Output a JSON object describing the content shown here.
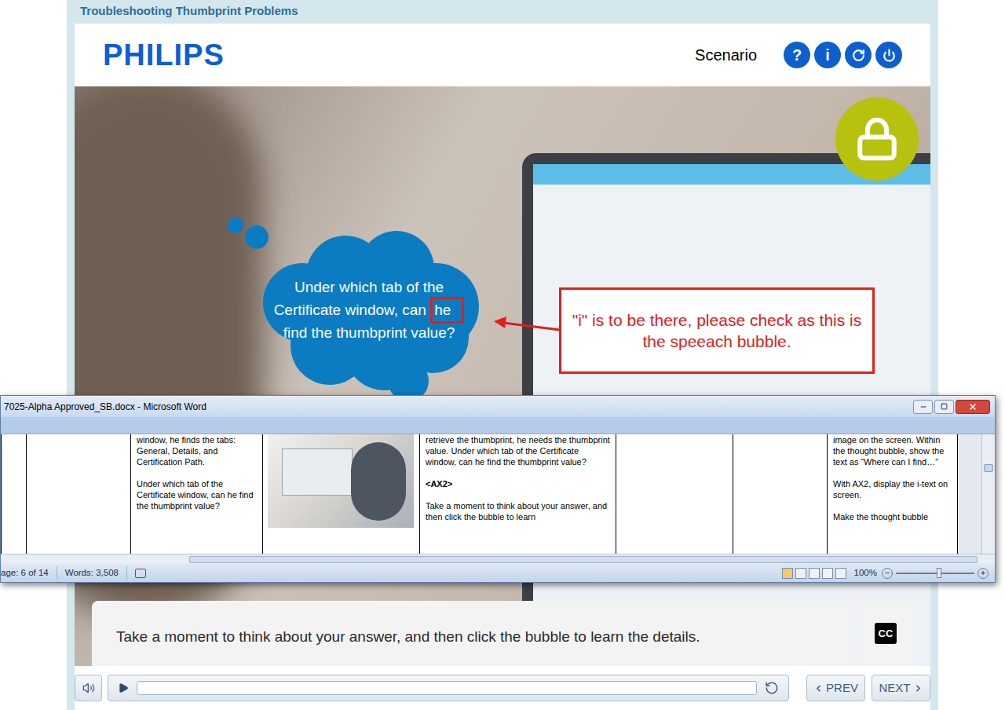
{
  "course": {
    "title": "Troubleshooting Thumbprint Problems",
    "logo": "PHILIPS",
    "section": "Scenario",
    "help_button": "?",
    "info_button": "i"
  },
  "thought_bubble": {
    "lines": [
      [
        {
          "text": "Under which tab of the",
          "highlighted": false
        }
      ],
      [
        {
          "text": "Certificate window, can ",
          "highlighted": false
        },
        {
          "text": "he",
          "highlighted": true
        }
      ],
      [
        {
          "text": "find the thumbprint value?",
          "highlighted": false
        }
      ]
    ]
  },
  "review_note": {
    "text": "\"i\" is to be there, please check as this is the speeach bubble."
  },
  "word_window": {
    "title": "7025-Alpha Approved_SB.docx - Microsoft Word",
    "table_cells": [
      {
        "kind": "empty",
        "paragraphs": []
      },
      {
        "kind": "empty",
        "paragraphs": []
      },
      {
        "kind": "text",
        "paragraphs": [
          {
            "text": "window, he finds the tabs: General, Details, and Certification Path.",
            "bold": false
          },
          {
            "text": "Under which tab of the Certificate window, can he find the thumbprint value?",
            "bold": false
          }
        ]
      },
      {
        "kind": "image",
        "paragraphs": []
      },
      {
        "kind": "text",
        "paragraphs": [
          {
            "text": "retrieve the thumbprint, he needs the thumbprint value. Under which tab of the Certificate window, can he find the thumbprint value?",
            "bold": false
          },
          {
            "text": "<AX2>",
            "bold": true
          },
          {
            "text": "Take a moment to think about your answer, and then click the bubble to learn",
            "bold": false
          }
        ]
      },
      {
        "kind": "empty",
        "paragraphs": []
      },
      {
        "kind": "empty",
        "paragraphs": []
      },
      {
        "kind": "text",
        "paragraphs": [
          {
            "text": "image on the screen. Within the thought bubble, show the text as “Where can I find…”",
            "bold": false
          },
          {
            "text": "With AX2, display the i-text on screen.",
            "bold": false
          },
          {
            "text": "Make the thought bubble",
            "bold": false
          }
        ]
      }
    ],
    "status_bar": {
      "page": "age: 6 of 14",
      "words": "Words: 3,508",
      "zoom": "100%",
      "zoom_out": "−",
      "zoom_in": "+"
    }
  },
  "caption": {
    "text": "Take a moment to think about your answer, and then click the bubble to learn the details.",
    "cc": "CC"
  },
  "player": {
    "level": 0,
    "prev": "PREV",
    "next": "NEXT"
  }
}
